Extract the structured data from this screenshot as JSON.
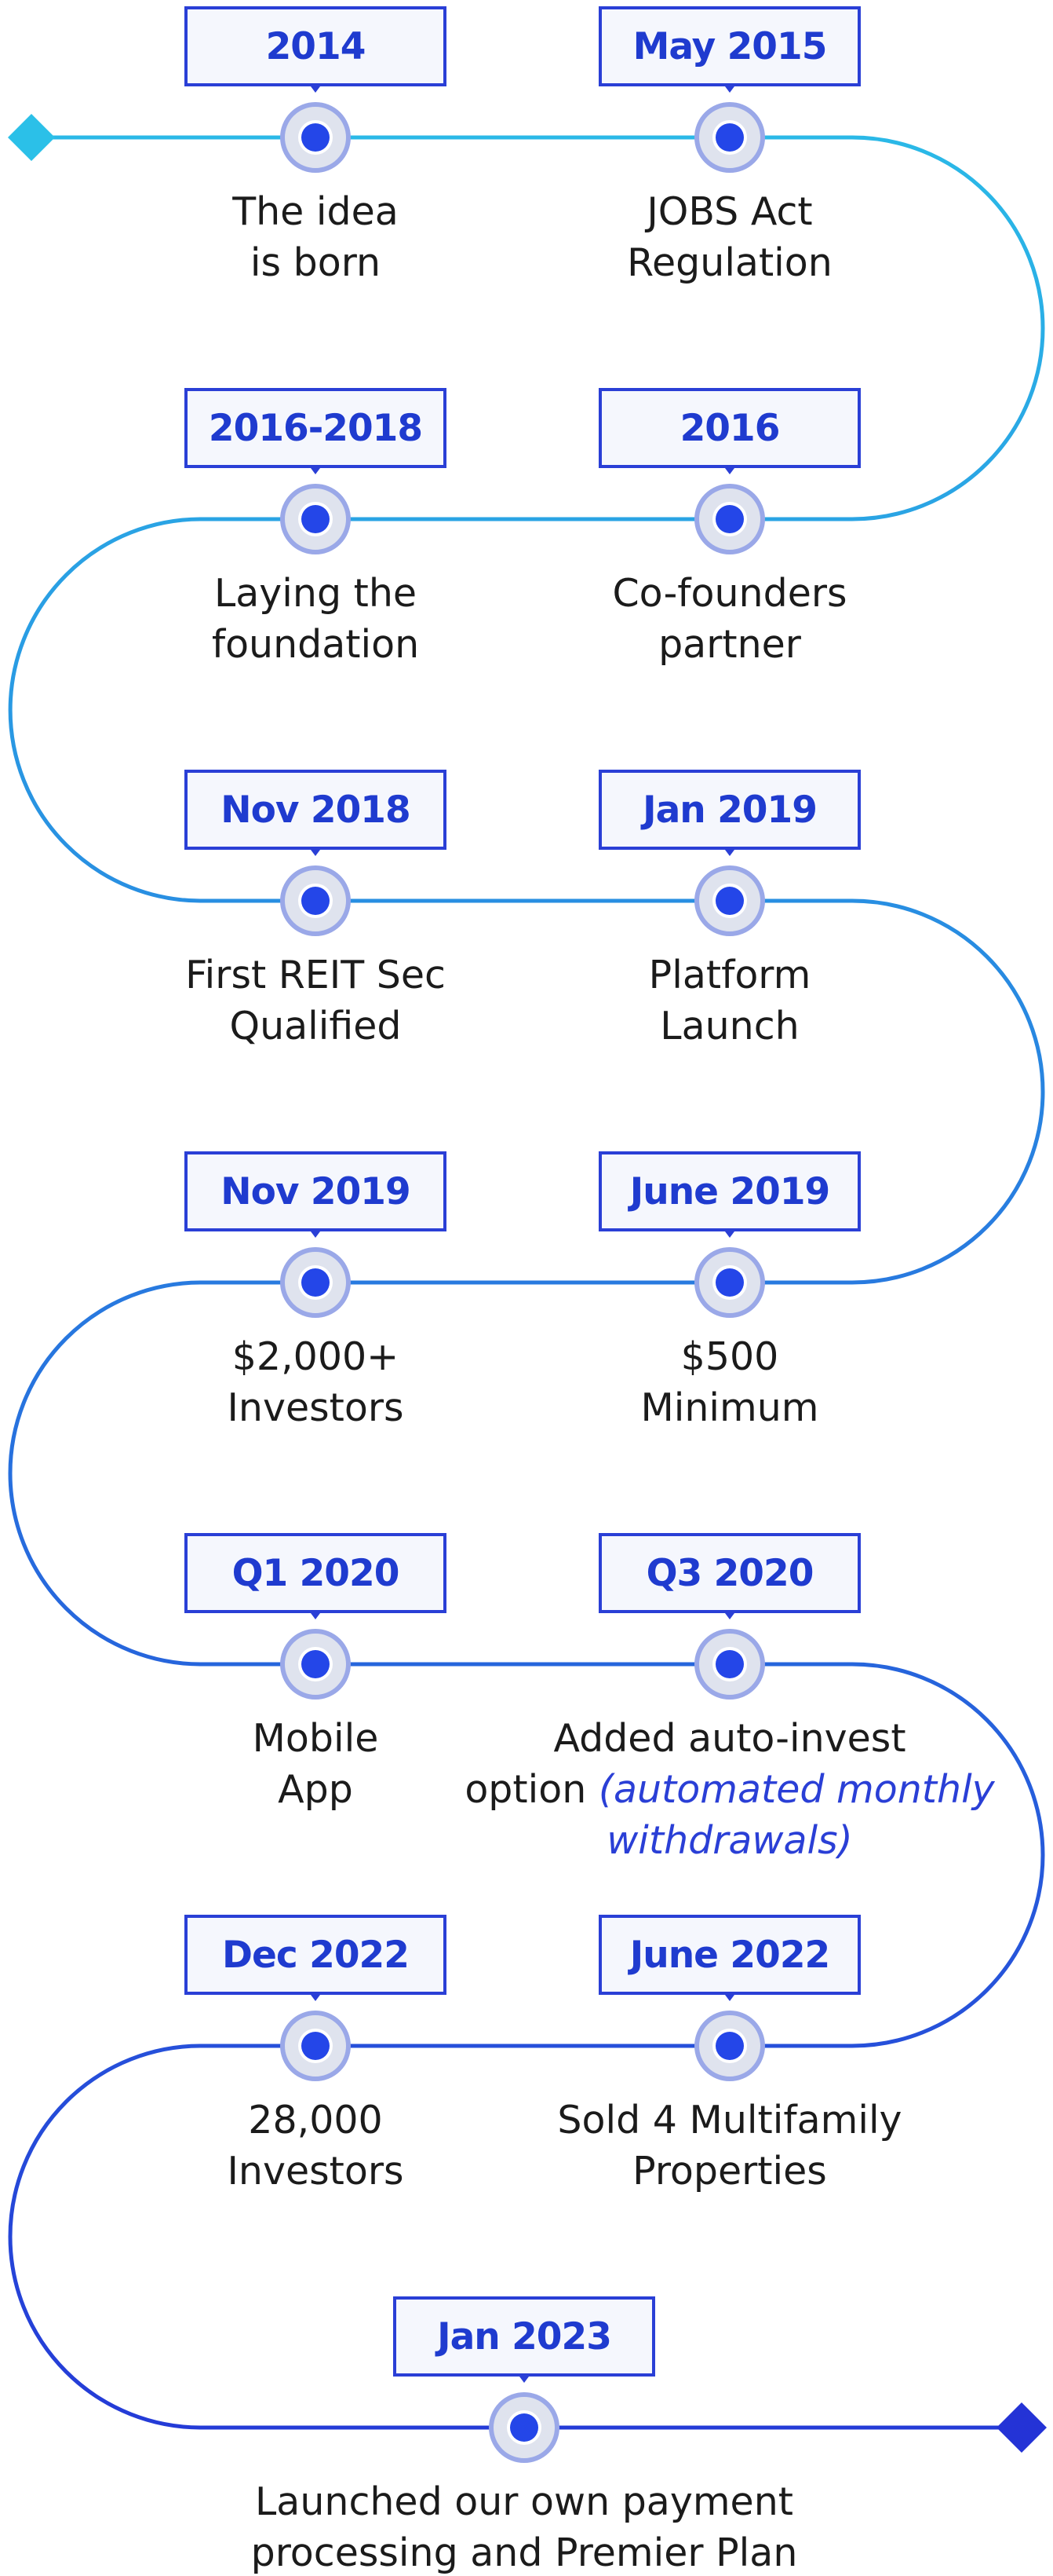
{
  "colors": {
    "accent": "#1f3bcf",
    "line_start": "#2bc0e8",
    "line_end": "#2433d6",
    "date_fill": "#f5f7fd",
    "text": "#1b1b1b"
  },
  "milestones": [
    {
      "date": "2014",
      "lines": [
        "The idea",
        "is born"
      ],
      "note": ""
    },
    {
      "date": "May 2015",
      "lines": [
        "JOBS Act",
        "Regulation"
      ],
      "note": ""
    },
    {
      "date": "2016",
      "lines": [
        "Co-founders",
        "partner"
      ],
      "note": ""
    },
    {
      "date": "2016-2018",
      "lines": [
        "Laying the",
        "foundation"
      ],
      "note": ""
    },
    {
      "date": "Nov 2018",
      "lines": [
        "First REIT Sec",
        "Qualified"
      ],
      "note": ""
    },
    {
      "date": "Jan 2019",
      "lines": [
        "Platform",
        "Launch"
      ],
      "note": ""
    },
    {
      "date": "June 2019",
      "lines": [
        "$500",
        "Minimum"
      ],
      "note": ""
    },
    {
      "date": "Nov 2019",
      "lines": [
        "$2,000+",
        "Investors"
      ],
      "note": ""
    },
    {
      "date": "Q1 2020",
      "lines": [
        "Mobile",
        "App"
      ],
      "note": ""
    },
    {
      "date": "Q3 2020",
      "lines": [
        "Added auto-invest",
        "option"
      ],
      "note": "(automated monthly withdrawals)"
    },
    {
      "date": "June 2022",
      "lines": [
        "Sold 4 Multifamily",
        "Properties"
      ],
      "note": ""
    },
    {
      "date": "Dec 2022",
      "lines": [
        "28,000",
        "Investors"
      ],
      "note": ""
    },
    {
      "date": "Jan 2023",
      "lines": [
        "Launched our own payment",
        "processing and Premier Plan"
      ],
      "note": ""
    }
  ]
}
